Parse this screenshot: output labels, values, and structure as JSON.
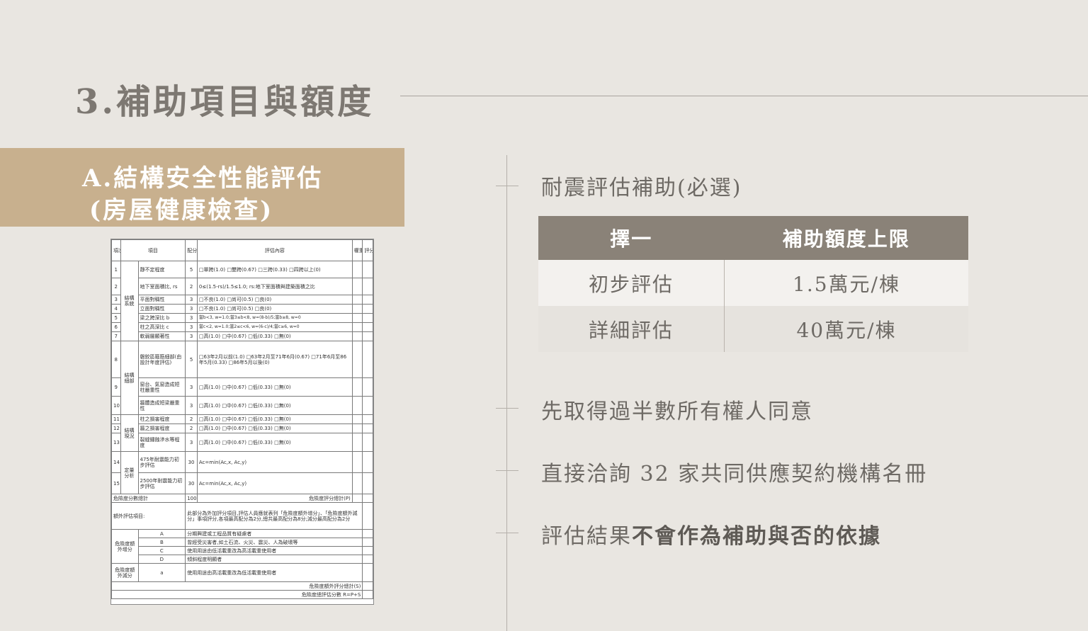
{
  "title": "3.補助項目與額度",
  "banner": {
    "line1": "A.結構安全性能評估",
    "line2": "(房屋健康檢查)"
  },
  "right": {
    "heading": "耐震評估補助(必選)",
    "table": {
      "headers": [
        "擇一",
        "補助額度上限"
      ],
      "rows": [
        [
          "初步評估",
          "1.5萬元/棟"
        ],
        [
          "詳細評估",
          "40萬元/棟"
        ]
      ]
    },
    "bullets": {
      "b1": "先取得過半數所有權人同意",
      "b2": "直接洽詢 32 家共同供應契約機構名冊",
      "b3_prefix": "評估結果",
      "b3_bold": "不會作為補助與否的依據"
    }
  },
  "form": {
    "headers": [
      "項次",
      "項目",
      "配分",
      "評估內容",
      "權重",
      "評分"
    ],
    "rows": [
      [
        "1",
        "結構系統",
        "靜不定程度",
        "5",
        "□單跨(1.0) □雙跨(0.67) □三跨(0.33) □四跨以上(0)"
      ],
      [
        "2",
        "",
        "地下室面積比, rs",
        "2",
        "0≤(1.5-rs)/1.5≤1.0; rs:地下室面積與建築面積之比"
      ],
      [
        "3",
        "",
        "平面對稱性",
        "3",
        "□不良(1.0) □尚可(0.5) □良(0)"
      ],
      [
        "4",
        "",
        "立面對稱性",
        "3",
        "□不良(1.0) □尚可(0.5) □良(0)"
      ],
      [
        "5",
        "",
        "梁之跨深比 b",
        "3",
        "當b<3, w=1.0;當3≤b<8, w=(8-b)/5;當b≥8, w=0"
      ],
      [
        "6",
        "",
        "柱之高深比 c",
        "3",
        "當c<2, w=1.0;當2≤c<6, w=(6-c)/4;當c≥6, w=0"
      ],
      [
        "7",
        "",
        "軟弱層顯著性",
        "3",
        "□高(1.0) □中(0.67) □低(0.33) □無(0)"
      ],
      [
        "8",
        "結構細部",
        "磐鉸區箍筋細部(由設計年度評估)",
        "5",
        "□63年2月以前(1.0) □63年2月至71年6月(0.67) □71年6月至86年5月(0.33) □86年5月以後(0)"
      ],
      [
        "9",
        "",
        "窗台、氣窗造成短柱嚴重性",
        "3",
        "□高(1.0) □中(0.67) □低(0.33) □無(0)"
      ],
      [
        "10",
        "",
        "牆體造成短梁嚴重性",
        "3",
        "□高(1.0) □中(0.67) □低(0.33) □無(0)"
      ],
      [
        "11",
        "結構現況",
        "柱之損害程度",
        "2",
        "□高(1.0) □中(0.67) □低(0.33) □無(0)"
      ],
      [
        "12",
        "",
        "牆之損害程度",
        "2",
        "□高(1.0) □中(0.67) □低(0.33) □無(0)"
      ],
      [
        "13",
        "",
        "裂縫鏽蝕滲水等程度",
        "3",
        "□高(1.0) □中(0.67) □低(0.33) □無(0)"
      ],
      [
        "14",
        "定量分析",
        "475年耐震能力初步評估",
        "30",
        "Ac=min(Ac,x, Ac,y)"
      ],
      [
        "15",
        "",
        "2500年耐震能力初步評估",
        "30",
        "Ac=min(Ac,x, Ac,y)"
      ]
    ],
    "total_label": "危險度分數總計",
    "total_score": "100",
    "total_right": "危險度評分總計(P)",
    "extra_label": "額外評估項目:",
    "extra_text": "此部分為外加評分項目,評估人員應就表列「危險度額外增分」、「危險度額外減分」事項評分,各項最高配分為2分,總共最高配分為8分;減分最高配分為2分",
    "plus_label": "危險度額外增分",
    "plus_items": [
      [
        "A",
        "分期興建或工程品質有疑慮者"
      ],
      [
        "B",
        "曾經受災害者,如土石流、火災、震災、人為破壞等"
      ],
      [
        "C",
        "使用用途由低活載重改為高活載重使用者"
      ],
      [
        "D",
        "傾斜程度明顯者"
      ]
    ],
    "minus_label": "危險度額外減分",
    "minus_item": [
      "a",
      "使用用途由高活載重改為低活載重使用者"
    ],
    "extra_total": "危險度額外評分總計(S)",
    "final_total": "危險度總評估分數 R=P+S"
  }
}
